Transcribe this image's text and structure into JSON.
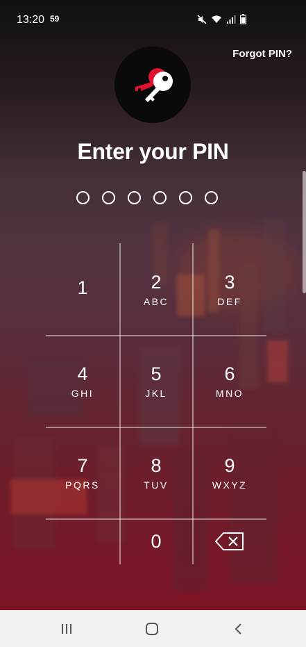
{
  "status_bar": {
    "time": "13:20",
    "notification_badge": "59",
    "icons": [
      "mute-icon",
      "wifi-icon",
      "signal-icon",
      "battery-icon"
    ]
  },
  "header": {
    "forgot_pin_label": "Forgot PIN?",
    "logo_icon": "key-logo-icon"
  },
  "main": {
    "title": "Enter your PIN",
    "pin_length": 6,
    "pin_entered": 0
  },
  "keypad": {
    "keys": [
      {
        "digit": "1",
        "letters": ""
      },
      {
        "digit": "2",
        "letters": "ABC"
      },
      {
        "digit": "3",
        "letters": "DEF"
      },
      {
        "digit": "4",
        "letters": "GHI"
      },
      {
        "digit": "5",
        "letters": "JKL"
      },
      {
        "digit": "6",
        "letters": "MNO"
      },
      {
        "digit": "7",
        "letters": "PQRS"
      },
      {
        "digit": "8",
        "letters": "TUV"
      },
      {
        "digit": "9",
        "letters": "WXYZ"
      },
      {
        "digit": "0",
        "letters": ""
      }
    ],
    "backspace_icon": "backspace-icon"
  },
  "nav_bar": {
    "icons": [
      "recent-apps-icon",
      "home-icon",
      "back-icon"
    ]
  },
  "colors": {
    "accent": "#e0122f",
    "nav_background": "#f2f2f2"
  }
}
